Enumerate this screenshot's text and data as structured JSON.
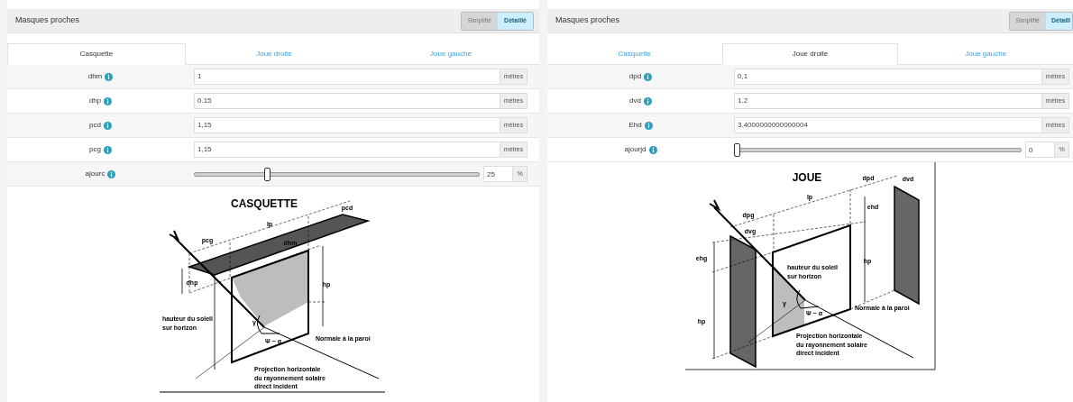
{
  "panels": [
    {
      "title": "Masques proches",
      "mode_buttons": [
        {
          "label": "Simplifié",
          "selected": false
        },
        {
          "label": "Détaillé",
          "selected": true
        }
      ],
      "tabs": [
        {
          "label": "Casquette",
          "selected": true
        },
        {
          "label": "Joue droite",
          "selected": false
        },
        {
          "label": "Joue gauche",
          "selected": false
        }
      ],
      "fields": [
        {
          "kind": "number",
          "label": "dhm",
          "value": "1",
          "unit": "mètres"
        },
        {
          "kind": "number",
          "label": "dhp",
          "value": "0.15",
          "unit": "mètres"
        },
        {
          "kind": "number",
          "label": "pcd",
          "value": "1,15",
          "unit": "mètres"
        },
        {
          "kind": "number",
          "label": "pcg",
          "value": "1,15",
          "unit": "mètres"
        },
        {
          "kind": "slider",
          "label": "ajourc",
          "level": 0.25,
          "value": "25",
          "unit": "%"
        }
      ],
      "diagram": {
        "kind": "casquette",
        "title": "CASQUETTE",
        "labels": [
          {
            "lines": [
              "pcd"
            ]
          },
          {
            "lines": [
              "lp"
            ]
          },
          {
            "lines": [
              "pcg"
            ]
          },
          {
            "lines": [
              "dhm"
            ]
          },
          {
            "lines": [
              "dhp"
            ]
          },
          {
            "lines": [
              "hp"
            ]
          },
          {
            "lines": [
              "hauteur du soleil",
              "sur horizon"
            ]
          },
          {
            "lines": [
              "γ"
            ]
          },
          {
            "lines": [
              "Ψ − α"
            ]
          },
          {
            "lines": [
              "Normale à la paroi"
            ]
          },
          {
            "lines": [
              "Projection horizontale",
              "du rayonnement solaire",
              "direct incident"
            ]
          }
        ]
      }
    },
    {
      "title": "Masques proches",
      "mode_buttons": [
        {
          "label": "Simplifié",
          "selected": false
        },
        {
          "label": "Détaill",
          "selected": true
        }
      ],
      "tabs": [
        {
          "label": "Casquette",
          "selected": false
        },
        {
          "label": "Joue droite",
          "selected": true
        },
        {
          "label": "Joue gauche",
          "selected": false
        }
      ],
      "fields": [
        {
          "kind": "number",
          "label": "dpd",
          "value": "0,1",
          "unit": "mètres"
        },
        {
          "kind": "number",
          "label": "dvd",
          "value": "1.2",
          "unit": "mètres"
        },
        {
          "kind": "number",
          "label": "Ehd",
          "value": "3.4000000000000004",
          "unit": "mètres"
        },
        {
          "kind": "slider",
          "label": "ajourjd",
          "level": 0,
          "value": "0",
          "unit": "%"
        }
      ],
      "diagram": {
        "kind": "joue",
        "title": "JOUE",
        "labels": [
          {
            "lines": [
              "dpd"
            ]
          },
          {
            "lines": [
              "dvd"
            ]
          },
          {
            "lines": [
              "lp"
            ]
          },
          {
            "lines": [
              "ehd"
            ]
          },
          {
            "lines": [
              "dpg"
            ]
          },
          {
            "lines": [
              "dvg"
            ]
          },
          {
            "lines": [
              "ehg"
            ]
          },
          {
            "lines": [
              "hp"
            ]
          },
          {
            "lines": [
              "hauteur du soleil",
              "sur horizon"
            ]
          },
          {
            "lines": [
              "γ"
            ]
          },
          {
            "lines": [
              "Ψ − α"
            ]
          },
          {
            "lines": [
              "Normale à la paroi"
            ]
          },
          {
            "lines": [
              "hp"
            ]
          },
          {
            "lines": [
              "Projection horizontale",
              "du rayonnement solaire",
              "direct incident"
            ]
          }
        ]
      }
    }
  ]
}
